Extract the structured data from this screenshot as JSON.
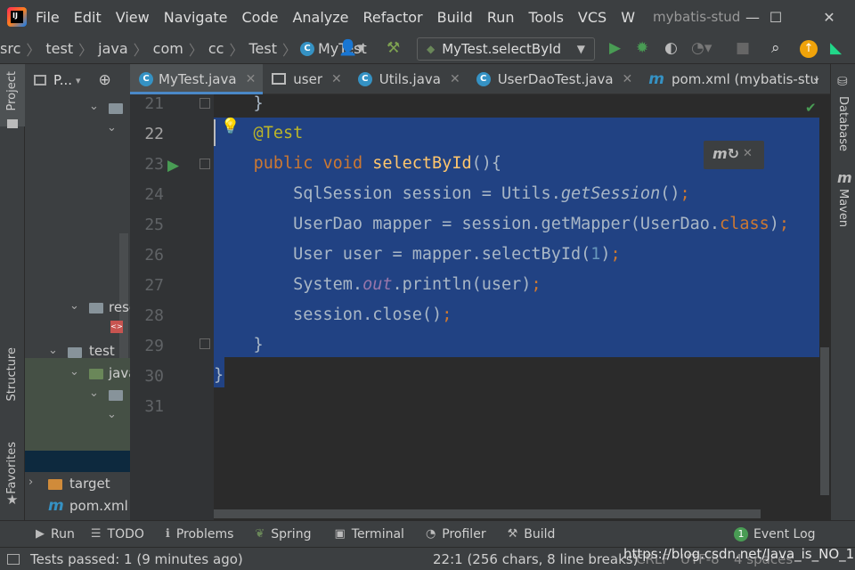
{
  "app": {
    "window_title": "mybatis-stud"
  },
  "menu": [
    "File",
    "Edit",
    "View",
    "Navigate",
    "Code",
    "Analyze",
    "Refactor",
    "Build",
    "Run",
    "Tools",
    "VCS",
    "W"
  ],
  "breadcrumb": [
    "src",
    "test",
    "java",
    "com",
    "cc",
    "Test",
    "MyTest"
  ],
  "run_config": "MyTest.selectById",
  "project_panel": {
    "title": "P...",
    "items": {
      "res": "rese",
      "test": "test",
      "java": "java",
      "target": "target",
      "pom": "pom.xml"
    }
  },
  "tabs": [
    {
      "label": "MyTest.java",
      "icon": "java-class-icon"
    },
    {
      "label": "user",
      "icon": "table-icon"
    },
    {
      "label": "Utils.java",
      "icon": "java-class-icon"
    },
    {
      "label": "UserDaoTest.java",
      "icon": "java-class-icon"
    },
    {
      "label": "pom.xml (mybatis-stu",
      "icon": "maven-icon"
    }
  ],
  "editor": {
    "line_numbers": [
      "21",
      "22",
      "23",
      "24",
      "25",
      "26",
      "27",
      "28",
      "29",
      "30",
      "31"
    ],
    "lines": [
      "    }",
      "    @Test",
      "    public void selectById(){",
      "        SqlSession session = Utils.getSession();",
      "        UserDao mapper = session.getMapper(UserDao.class);",
      "        User user = mapper.selectById(1);",
      "        System.out.println(user);",
      "        session.close();",
      "    }",
      "}",
      ""
    ]
  },
  "right_strip": {
    "database": "Database",
    "maven": "Maven"
  },
  "left_strip": {
    "project": "Project",
    "structure": "Structure",
    "favorites": "Favorites"
  },
  "tool_windows": [
    "Run",
    "TODO",
    "Problems",
    "Spring",
    "Terminal",
    "Profiler",
    "Build"
  ],
  "event_log": {
    "count": "1",
    "label": "Event Log"
  },
  "status": {
    "message": "Tests passed: 1 (9 minutes ago)",
    "position": "22:1 (256 chars, 8 line breaks)",
    "line_sep": "CRLF",
    "encoding": "UTF-8",
    "indent": "4 spaces",
    "watermark": "https://blog.csdn.net/Java_is_NO_1"
  },
  "colors": {
    "selection": "#214283",
    "accent": "#4a88c7",
    "keyword": "#cc7832",
    "annotation": "#bbb529",
    "method": "#ffc66d",
    "number": "#6897bb"
  }
}
